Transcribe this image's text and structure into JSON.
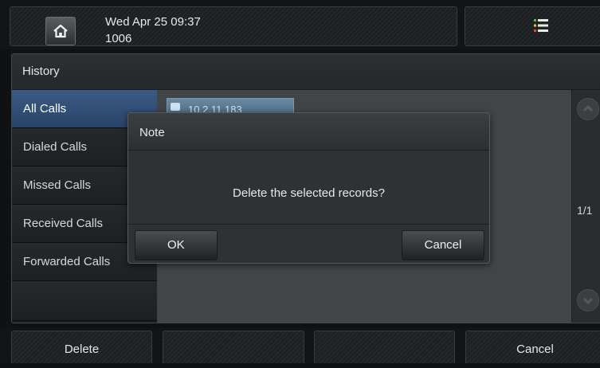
{
  "status_bar": {
    "date_time": "Wed Apr 25 09:37",
    "extension": "1006",
    "home_icon": "home-icon",
    "menu_icon": "menu-icon"
  },
  "panel": {
    "title": "History"
  },
  "sidebar": {
    "items": [
      {
        "label": "All Calls",
        "active": true
      },
      {
        "label": "Dialed Calls",
        "active": false
      },
      {
        "label": "Missed Calls",
        "active": false
      },
      {
        "label": "Received Calls",
        "active": false
      },
      {
        "label": "Forwarded Calls",
        "active": false
      }
    ]
  },
  "history_list": {
    "records": [
      {
        "text": "10.2.11.183"
      }
    ],
    "page_indicator": "1/1"
  },
  "dialog": {
    "title": "Note",
    "message": "Delete the selected records?",
    "ok_label": "OK",
    "cancel_label": "Cancel"
  },
  "softkeys": {
    "key1": "Delete",
    "key2": "",
    "key3": "",
    "key4": "Cancel"
  },
  "colors": {
    "accent_selected": "#3a5a85",
    "background": "#0f1112"
  }
}
